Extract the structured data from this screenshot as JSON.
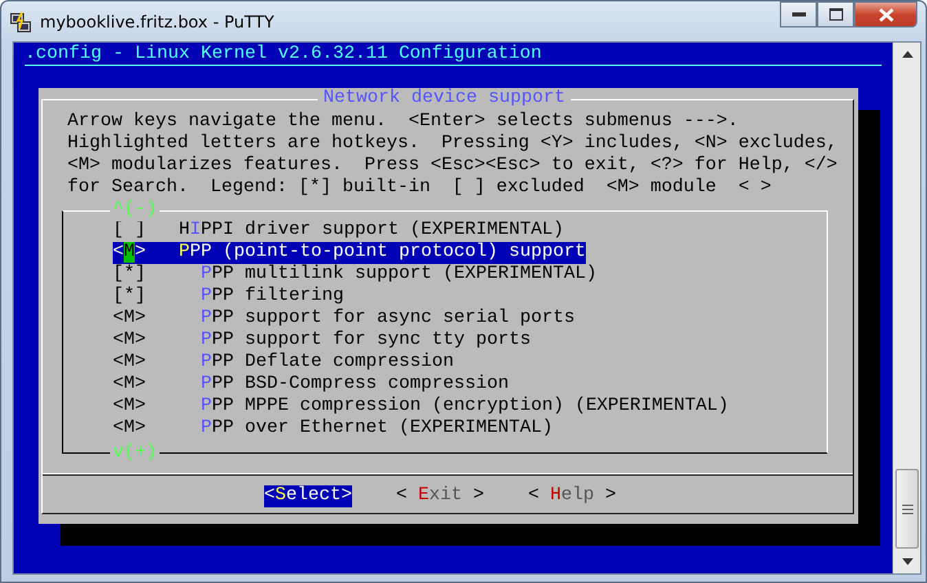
{
  "window": {
    "title": "mybooklive.fritz.box - PuTTY"
  },
  "terminal": {
    "header": ".config - Linux Kernel v2.6.32.11 Configuration",
    "dialog": {
      "title": "Network device support",
      "help": [
        "Arrow keys navigate the menu.  <Enter> selects submenus --->.",
        "Highlighted letters are hotkeys.  Pressing <Y> includes, <N> excludes,",
        "<M> modularizes features.  Press <Esc><Esc> to exit, <?> for Help, </>",
        "for Search.  Legend: [*] built-in  [ ] excluded  <M> module  < >"
      ],
      "scroll_up": "^(-)",
      "scroll_down": "v(+)",
      "items": [
        {
          "state": "[ ]",
          "before": "H",
          "hotkey": "I",
          "after": "PPI driver support (EXPERIMENTAL)",
          "selected": false
        },
        {
          "state": "<M>",
          "hotkey": "P",
          "after": "PP (point-to-point protocol) support",
          "selected": true,
          "children": [
            {
              "state": "[*]",
              "hotkey": "P",
              "after": "PP multilink support (EXPERIMENTAL)",
              "selected": false
            },
            {
              "state": "[*]",
              "hotkey": "P",
              "after": "PP filtering",
              "selected": false
            },
            {
              "state": "<M>",
              "hotkey": "P",
              "after": "PP support for async serial ports",
              "selected": false
            },
            {
              "state": "<M>",
              "hotkey": "P",
              "after": "PP support for sync tty ports",
              "selected": false
            },
            {
              "state": "<M>",
              "hotkey": "P",
              "after": "PP Deflate compression",
              "selected": false
            },
            {
              "state": "<M>",
              "hotkey": "P",
              "after": "PP BSD-Compress compression",
              "selected": false
            },
            {
              "state": "<M>",
              "hotkey": "P",
              "after": "PP MPPE compression (encryption) (EXPERIMENTAL)",
              "selected": false
            },
            {
              "state": "<M>",
              "hotkey": "P",
              "after": "PP over Ethernet (EXPERIMENTAL)",
              "selected": false
            }
          ]
        }
      ],
      "buttons": [
        {
          "before": "<",
          "hotkey": "S",
          "after": "elect>",
          "selected": true
        },
        {
          "before": "< ",
          "hotkey": "E",
          "after": "xit >",
          "selected": false
        },
        {
          "before": "< ",
          "hotkey": "H",
          "after": "elp >",
          "selected": false
        }
      ]
    }
  }
}
